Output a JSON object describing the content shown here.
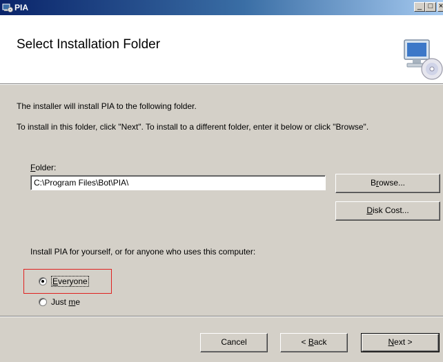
{
  "window": {
    "title": "PIA",
    "icon": "installer-icon",
    "controls": {
      "minimize": "_",
      "maximize": "□",
      "close": "×"
    }
  },
  "banner": {
    "heading": "Select Installation Folder",
    "icon": "computer-disc-icon"
  },
  "body": {
    "intro": "The installer will install PIA to the following folder.",
    "instructions": "To install in this folder, click \"Next\". To install to a different folder, enter it below or click \"Browse\"."
  },
  "folder": {
    "label_mnemonic": "F",
    "label_rest": "older:",
    "value": "C:\\Program Files\\Bot\\PIA\\",
    "browse_mnemonic": "r",
    "browse_pre": "B",
    "browse_post": "owse...",
    "diskcost_mnemonic": "D",
    "diskcost_rest": "isk Cost..."
  },
  "install_for": {
    "prompt": "Install PIA for yourself, or for anyone who uses this computer:",
    "options": [
      {
        "mnemonic": "E",
        "rest": "veryone",
        "selected": true
      },
      {
        "pre": "Just ",
        "mnemonic": "m",
        "rest": "e",
        "selected": false
      }
    ]
  },
  "footer": {
    "cancel": "Cancel",
    "back_pre": "< ",
    "back_mnemonic": "B",
    "back_rest": "ack",
    "next_mnemonic": "N",
    "next_rest": "ext >"
  },
  "colors": {
    "titlebar_start": "#0a246a",
    "titlebar_end": "#a6caf0",
    "dialog_bg": "#d4d0c8",
    "highlight_box": "#e0201e"
  }
}
